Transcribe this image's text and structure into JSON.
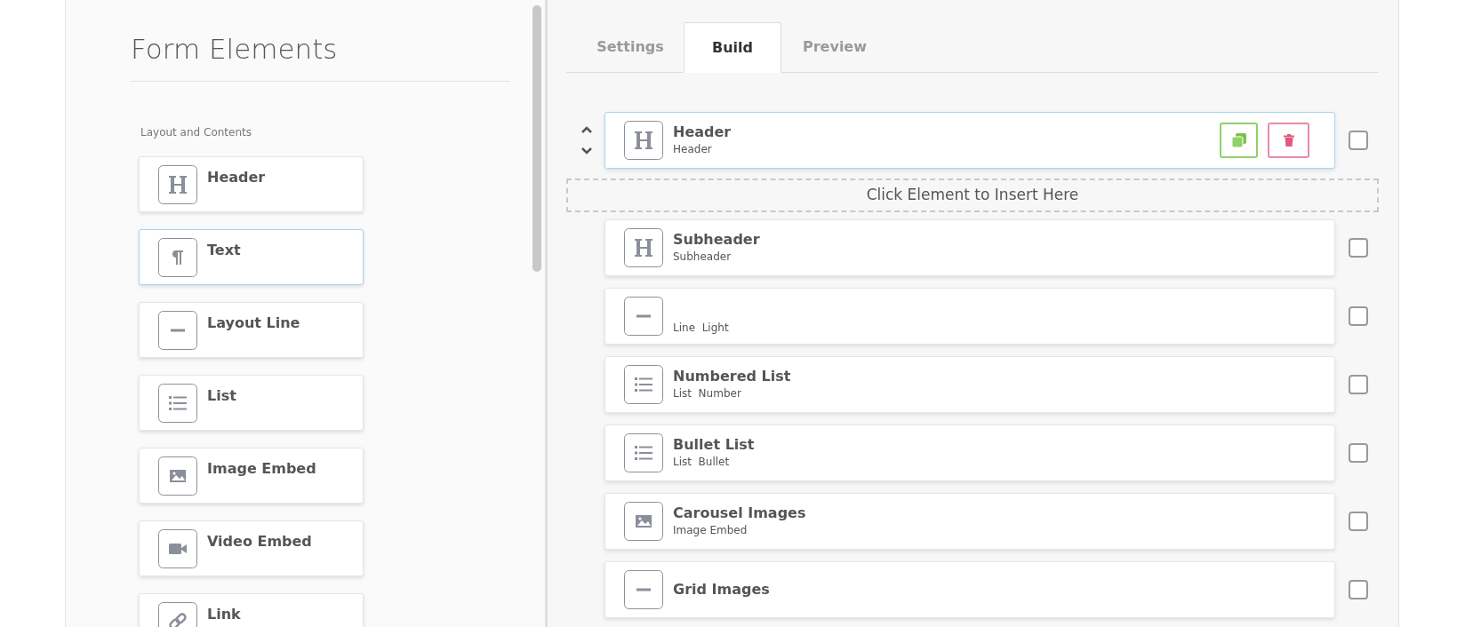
{
  "palette": {
    "title": "Form Elements",
    "section": "Layout and Contents",
    "items": [
      {
        "label": "Header",
        "kind": "heading",
        "highlighted": false
      },
      {
        "label": "Text",
        "kind": "paragraph",
        "highlighted": true
      },
      {
        "label": "Layout Line",
        "kind": "line",
        "highlighted": false
      },
      {
        "label": "List",
        "kind": "list",
        "highlighted": false
      },
      {
        "label": "Image Embed",
        "kind": "image",
        "highlighted": false
      },
      {
        "label": "Video Embed",
        "kind": "video",
        "highlighted": false
      },
      {
        "label": "Link",
        "kind": "link",
        "highlighted": false
      }
    ]
  },
  "tabs": [
    {
      "label": "Settings",
      "selected": false
    },
    {
      "label": "Build",
      "selected": true
    },
    {
      "label": "Preview",
      "selected": false
    }
  ],
  "insert_zone": {
    "label": "Click Element to Insert Here"
  },
  "rows": [
    {
      "title": "Header",
      "subtitle": "Header",
      "kind": "heading",
      "selected": true,
      "checked": false
    },
    {
      "title": "Subheader",
      "subtitle": "Subheader",
      "kind": "heading",
      "selected": false,
      "checked": false
    },
    {
      "subtitle": "Line  Light",
      "kind": "line",
      "selected": false,
      "checked": false
    },
    {
      "title": "Numbered List",
      "subtitle": "List  Number",
      "kind": "list",
      "selected": false,
      "checked": false
    },
    {
      "title": "Bullet List",
      "subtitle": "List  Bullet",
      "kind": "list",
      "selected": false,
      "checked": false
    },
    {
      "title": "Carousel Images",
      "subtitle": "Image Embed",
      "kind": "image",
      "selected": false,
      "checked": false
    },
    {
      "title": "Grid Images",
      "kind": "line",
      "selected": false,
      "checked": false
    }
  ]
}
